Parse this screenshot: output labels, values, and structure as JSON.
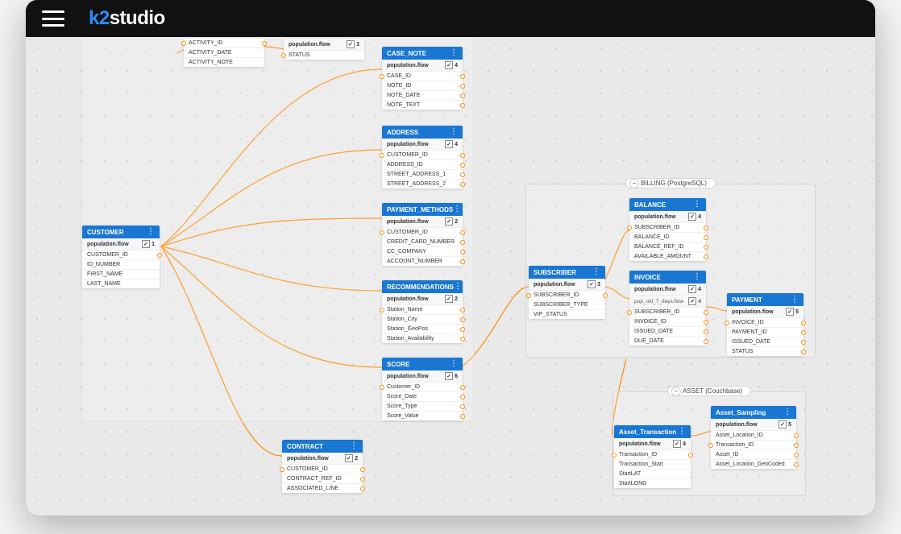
{
  "app": {
    "logo_prefix": "k2",
    "logo_suffix": "studio"
  },
  "zones": {
    "billing": "BILLING (PostgreSQL)",
    "asset": "ASSET (Couchbase)"
  },
  "entities": {
    "customer": {
      "title": "CUSTOMER",
      "sub": "population.flow",
      "count": "1",
      "rows": [
        "CUSTOMER_ID",
        "ID_NUMBER",
        "FIRST_NAME",
        "LAST_NAME"
      ]
    },
    "activity": {
      "rows": [
        "ACTIVITY_ID",
        "ACTIVITY_DATE",
        "ACTIVITY_NOTE"
      ]
    },
    "status": {
      "sub": "population.flow",
      "count": "3",
      "rows": [
        "STATUS"
      ]
    },
    "case_note": {
      "title": "CASE_NOTE",
      "sub": "population.flow",
      "count": "4",
      "rows": [
        "CASE_ID",
        "NOTE_ID",
        "NOTE_DATE",
        "NOTE_TEXT"
      ]
    },
    "address": {
      "title": "ADDRESS",
      "sub": "population.flow",
      "count": "4",
      "rows": [
        "CUSTOMER_ID",
        "ADDRESS_ID",
        "STREET_ADDRESS_1",
        "STREET_ADDRESS_2"
      ]
    },
    "payment_methods": {
      "title": "PAYMENT_METHODS",
      "sub": "population.flow",
      "count": "2",
      "rows": [
        "CUSTOMER_ID",
        "CREDIT_CARD_NUMBER",
        "CC_COMPANY",
        "ACCOUNT_NUMBER"
      ]
    },
    "recommendations": {
      "title": "RECOMMENDATIONS",
      "sub": "population.flow",
      "count": "2",
      "rows": [
        "Station_Name",
        "Station_City",
        "Station_GeoPos",
        "Station_Availability"
      ]
    },
    "score": {
      "title": "SCORE",
      "sub": "population.flow",
      "count": "6",
      "rows": [
        "Customer_ID",
        "Score_Date",
        "Score_Type",
        "Score_Value"
      ]
    },
    "contract": {
      "title": "CONTRACT",
      "sub": "population.flow",
      "count": "2",
      "rows": [
        "CUSTOMER_ID",
        "CONTRACT_REF_ID",
        "ASSOCIATED_LINE"
      ]
    },
    "subscriber": {
      "title": "SUBSCRIBER",
      "sub": "population.flow",
      "count": "3",
      "rows": [
        "SUBSCRIBER_ID",
        "SUBSCRIBER_TYPE",
        "VIP_STATUS"
      ]
    },
    "balance": {
      "title": "BALANCE",
      "sub": "population.flow",
      "count": "4",
      "rows": [
        "SUBSCRIBER_ID",
        "BALANCE_ID",
        "BALANCE_REF_ID",
        "AVAILABLE_AMOUNT"
      ]
    },
    "invoice": {
      "title": "INVOICE",
      "sub": "population.flow",
      "count": "4",
      "sub2": "pop_old_7_days.flow",
      "count2": "4",
      "rows": [
        "SUBSCRIBER_ID",
        "INVOICE_ID",
        "ISSUED_DATE",
        "DUE_DATE"
      ]
    },
    "payment": {
      "title": "PAYMENT",
      "sub": "population.flow",
      "count": "5",
      "rows": [
        "INVOICE_ID",
        "PAYMENT_ID",
        "ISSUED_DATE",
        "STATUS"
      ]
    },
    "asset_transaction": {
      "title": "Asset_Transaction",
      "sub": "population.flow",
      "count": "4",
      "rows": [
        "Transaction_ID",
        "Transaction_Start",
        "StartLAT",
        "StartLONG"
      ]
    },
    "asset_sampling": {
      "title": "Asset_Sampling",
      "sub": "population.flow",
      "count": "5",
      "rows": [
        "Asset_Location_ID",
        "Transaction_ID",
        "Asset_ID",
        "Asset_Location_GeoCoded"
      ]
    }
  }
}
